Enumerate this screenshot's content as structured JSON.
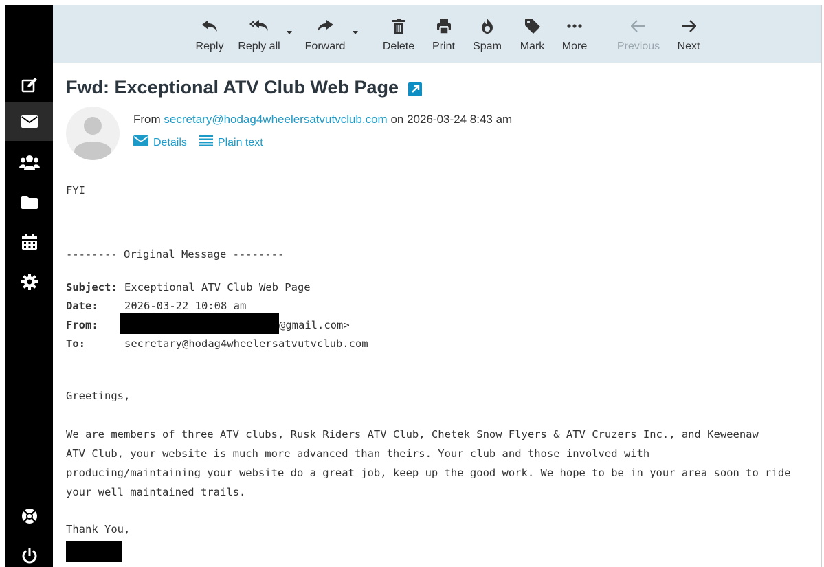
{
  "toolbar": {
    "reply": "Reply",
    "reply_all": "Reply all",
    "forward": "Forward",
    "delete": "Delete",
    "print": "Print",
    "spam": "Spam",
    "mark": "Mark",
    "more": "More",
    "previous": "Previous",
    "next": "Next"
  },
  "sidebar": {
    "items": [
      {
        "icon": "compose-icon"
      },
      {
        "icon": "mail-icon"
      },
      {
        "icon": "contacts-icon"
      },
      {
        "icon": "folder-icon"
      },
      {
        "icon": "calendar-icon"
      },
      {
        "icon": "settings-icon"
      },
      {
        "icon": "help-icon"
      },
      {
        "icon": "logout-icon"
      }
    ]
  },
  "message": {
    "subject": "Fwd: Exceptional ATV Club Web Page",
    "from_prefix": "From",
    "from_address": "secretary@hodag4wheelersatvutvclub.com",
    "date_text": "on 2026-03-24 8:43 am",
    "details_label": "Details",
    "plain_text_label": "Plain text"
  },
  "body": {
    "fyi": "FYI",
    "original_header": "-------- Original Message --------",
    "subject_label": "Subject:",
    "subject_value": "Exceptional ATV Club Web Page",
    "date_label": "Date:",
    "date_value": "2026-03-22 10:08 am",
    "from_label": "From:",
    "from_value_suffix": "@gmail.com>",
    "to_label": "To:",
    "to_value": "secretary@hodag4wheelersatvutvclub.com",
    "greeting": "Greetings,",
    "paragraph_lines": [
      "We are members of three ATV clubs, Rusk Riders ATV Club, Chetek Snow Flyers & ATV Cruzers Inc., and Keweenaw",
      "ATV Club, your website is much more advanced than theirs.  Your club and those involved with",
      "producing/maintaining your website do a great job, keep up the good work.  We hope to be in your area soon to ride",
      "your well maintained trails."
    ],
    "closing": "Thank You,"
  },
  "colors": {
    "toolbar_bg": "#dde8ef",
    "link": "#1c9bc9",
    "sidebar_bg": "#000000"
  }
}
